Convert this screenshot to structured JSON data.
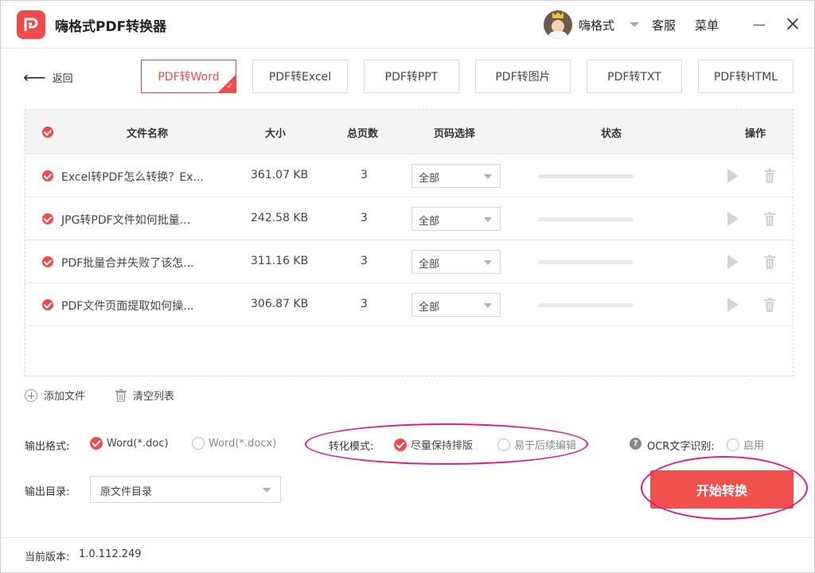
{
  "app": {
    "title": "嗨格式PDF转换器",
    "username": "嗨格式",
    "service_label": "客服",
    "menu_label": "菜单"
  },
  "nav": {
    "back_label": "返回"
  },
  "tabs": [
    {
      "label": "PDF转Word",
      "active": true
    },
    {
      "label": "PDF转Excel"
    },
    {
      "label": "PDF转PPT"
    },
    {
      "label": "PDF转图片"
    },
    {
      "label": "PDF转TXT"
    },
    {
      "label": "PDF转HTML"
    }
  ],
  "table": {
    "headers": {
      "name": "文件名称",
      "size": "大小",
      "pages": "总页数",
      "page_select": "页码选择",
      "status": "状态",
      "actions": "操作"
    },
    "rows": [
      {
        "name": "Excel转PDF怎么转换？Ex...",
        "size": "361.07 KB",
        "pages": "3",
        "page_select": "全部",
        "progress": 0
      },
      {
        "name": "JPG转PDF文件如何批量...",
        "size": "242.58 KB",
        "pages": "3",
        "page_select": "全部",
        "progress": 0
      },
      {
        "name": "PDF批量合并失败了该怎...",
        "size": "311.16 KB",
        "pages": "3",
        "page_select": "全部",
        "progress": 0
      },
      {
        "name": "PDF文件页面提取如何操...",
        "size": "306.87 KB",
        "pages": "3",
        "page_select": "全部",
        "progress": 0
      }
    ]
  },
  "actions": {
    "add_file": "添加文件",
    "clear_list": "清空列表"
  },
  "options": {
    "output_format_label": "输出格式:",
    "format_doc": "Word(*.doc)",
    "format_docx": "Word(*.docx)",
    "mode_label": "转化模式:",
    "mode_keep_layout": "尽量保持排版",
    "mode_easy_edit": "易于后续编辑",
    "ocr_label": "OCR文字识别:",
    "ocr_enable": "启用",
    "output_dir_label": "输出目录:",
    "output_dir_value": "原文件目录"
  },
  "start_button": "开始转换",
  "footer": {
    "version_label": "当前版本:",
    "version_value": "1.0.112.249"
  },
  "colors": {
    "accent": "#f04a4a",
    "annotation": "#e6198c"
  }
}
